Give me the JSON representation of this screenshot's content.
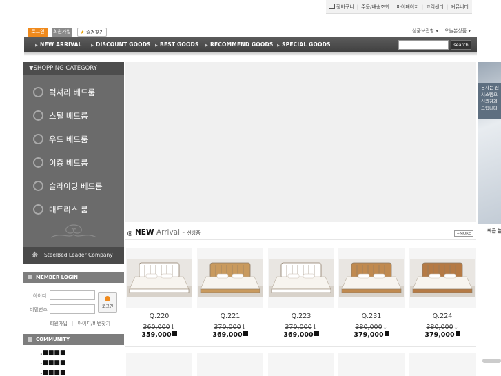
{
  "util_bar": {
    "cart": "장바구니",
    "order": "주문/배송조회",
    "mypage": "마이페이지",
    "cs": "고객센터",
    "community": "커뮤니티"
  },
  "top_buttons": {
    "login": "로그인",
    "join": "회원가입",
    "favorite": "즐겨찾기"
  },
  "top_selects": {
    "product_storage": "상품보관함",
    "today_viewed": "오늘본상품"
  },
  "nav": {
    "items": [
      "NEW ARRIVAL",
      "DISCOUNT GOODS",
      "BEST GOODS",
      "RECOMMEND GOODS",
      "SPECIAL GOODS"
    ],
    "search_button": "search"
  },
  "category": {
    "title": "SHOPPING CATEGORY",
    "items": [
      "럭셔리 베드룸",
      "스틸 베드룸",
      "우드 베드룸",
      "이층 베드룸",
      "슬라이딩 베드룸",
      "매트리스 룸"
    ],
    "footer": "SteelBed Leader Company"
  },
  "member_login": {
    "title": "MEMBER LOGIN",
    "id_label": "아이디",
    "pw_label": "비밀번호",
    "login_button": "로그인",
    "join_link": "회원가입",
    "find_link": "아이디/비번찾기"
  },
  "community": {
    "title": "COMMUNITY",
    "items": [
      ".■■■■",
      ".■■■■",
      ".■■■■"
    ]
  },
  "arrival": {
    "title_bold": "NEW",
    "title_light": "Arrival -",
    "title_korean": "신상품",
    "more": "+MORE",
    "products": [
      {
        "model": "Q.220",
        "old_price": "360,000",
        "new_price": "359,000",
        "frame": "#ffffff"
      },
      {
        "model": "Q.221",
        "old_price": "370,000",
        "new_price": "369,000",
        "frame": "#c99a5e"
      },
      {
        "model": "Q.223",
        "old_price": "370,000",
        "new_price": "369,000",
        "frame": "#ffffff"
      },
      {
        "model": "Q.231",
        "old_price": "380,000",
        "new_price": "379,000",
        "frame": "#c08a50"
      },
      {
        "model": "Q.224",
        "old_price": "380,000",
        "new_price": "379,000",
        "frame": "#b57a45"
      }
    ],
    "arrow": "↓"
  },
  "right_panel": {
    "text_lines": [
      "본사는 진",
      "시스템으",
      "신뢰감과",
      "드립니다"
    ],
    "recent": "최근 본"
  },
  "colors": {
    "accent": "#f08a1c",
    "nav_bg": "#4a4a4a",
    "category_bg": "#6b6b6b"
  }
}
